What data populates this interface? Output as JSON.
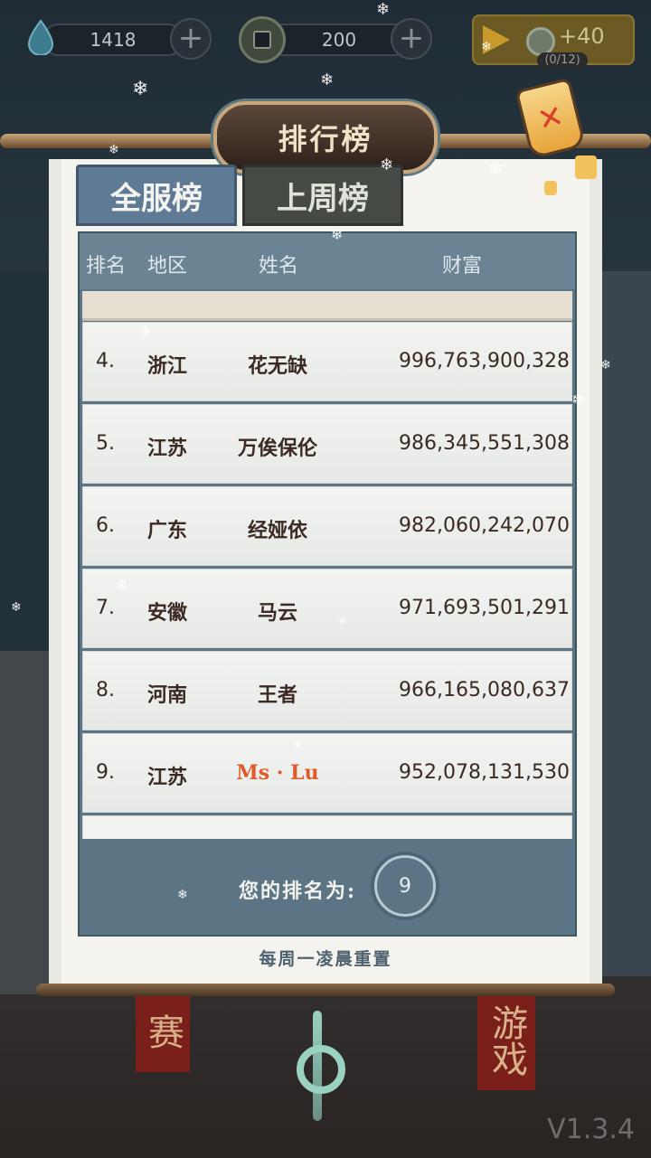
{
  "top_bar": {
    "currency1": {
      "icon": "water-drop-icon",
      "value": "1418"
    },
    "currency2": {
      "icon": "copper-coin-icon",
      "value": "200"
    },
    "video_reward": {
      "icon": "play-icon",
      "reward": "+40",
      "count": "(0/12)"
    }
  },
  "title": "排行榜",
  "tabs": [
    {
      "label": "全服榜",
      "active": true
    },
    {
      "label": "上周榜",
      "active": false
    }
  ],
  "table": {
    "headers": [
      "排名",
      "地区",
      "姓名",
      "财富"
    ],
    "rows": [
      {
        "rank": "4.",
        "region": "浙江",
        "name": "花无缺",
        "wealth": "996,763,900,328",
        "highlight": false
      },
      {
        "rank": "5.",
        "region": "江苏",
        "name": "万俟保伦",
        "wealth": "986,345,551,308",
        "highlight": false
      },
      {
        "rank": "6.",
        "region": "广东",
        "name": "经娅依",
        "wealth": "982,060,242,070",
        "highlight": false
      },
      {
        "rank": "7.",
        "region": "安徽",
        "name": "马云",
        "wealth": "971,693,501,291",
        "highlight": false
      },
      {
        "rank": "8.",
        "region": "河南",
        "name": "王者",
        "wealth": "966,165,080,637",
        "highlight": false
      },
      {
        "rank": "9.",
        "region": "江苏",
        "name": "Ms · Lu",
        "wealth": "952,078,131,530",
        "highlight": true
      }
    ]
  },
  "my_rank": {
    "label": "您的排名为:",
    "value": "9"
  },
  "reset_note": "每周一凌晨重置",
  "background": {
    "banner_left": "赛",
    "banner_right": "游戏"
  },
  "version": "V1.3.4",
  "colors": {
    "highlight": "#e05a2a",
    "tab_active": "#5f7a94",
    "tab_inactive": "#454a45",
    "panel": "#5c7584"
  }
}
